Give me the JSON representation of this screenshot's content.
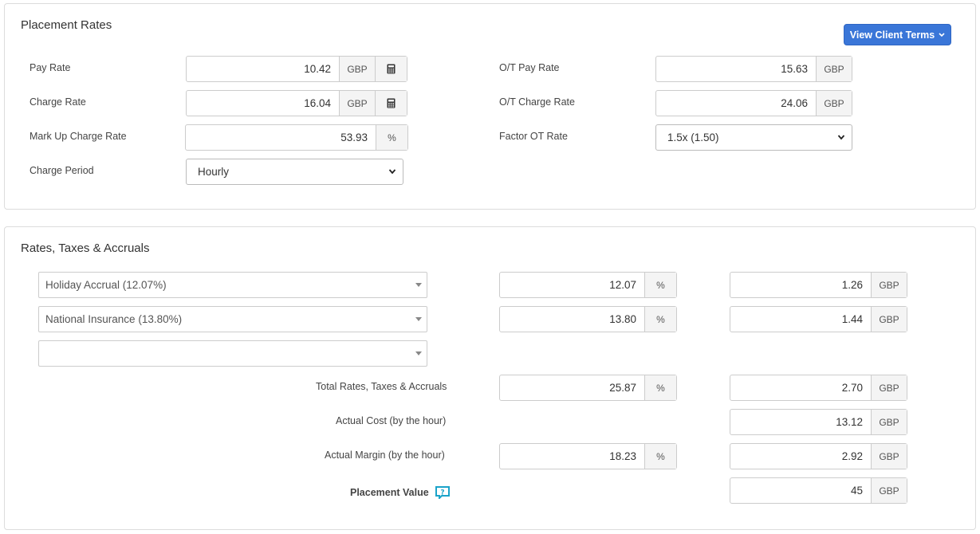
{
  "placement_rates": {
    "title": "Placement Rates",
    "view_client_terms_label": "View Client Terms",
    "pay_rate": {
      "label": "Pay Rate",
      "value": "10.42",
      "unit": "GBP"
    },
    "charge_rate": {
      "label": "Charge Rate",
      "value": "16.04",
      "unit": "GBP"
    },
    "markup": {
      "label": "Mark Up Charge Rate",
      "value": "53.93",
      "unit": "%"
    },
    "charge_period": {
      "label": "Charge Period",
      "value": "Hourly"
    },
    "ot_pay_rate": {
      "label": "O/T Pay Rate",
      "value": "15.63",
      "unit": "GBP"
    },
    "ot_charge_rate": {
      "label": "O/T Charge Rate",
      "value": "24.06",
      "unit": "GBP"
    },
    "factor_ot_rate": {
      "label": "Factor OT Rate",
      "value": "1.5x (1.50)"
    }
  },
  "rates_taxes": {
    "title": "Rates, Taxes & Accruals",
    "rows": [
      {
        "select": "Holiday Accrual (12.07%)",
        "percent": "12.07",
        "pct_unit": "%",
        "amount": "1.26",
        "amount_unit": "GBP"
      },
      {
        "select": "National Insurance (13.80%)",
        "percent": "13.80",
        "pct_unit": "%",
        "amount": "1.44",
        "amount_unit": "GBP"
      },
      {
        "select": ""
      }
    ],
    "total": {
      "label": "Total Rates, Taxes & Accruals",
      "percent": "25.87",
      "pct_unit": "%",
      "amount": "2.70",
      "amount_unit": "GBP"
    },
    "actual_cost": {
      "label": "Actual Cost (by the hour)",
      "amount": "13.12",
      "amount_unit": "GBP"
    },
    "actual_margin": {
      "label": "Actual Margin (by the hour)",
      "percent": "18.23",
      "pct_unit": "%",
      "amount": "2.92",
      "amount_unit": "GBP"
    },
    "placement_value": {
      "label": "Placement Value",
      "amount": "45",
      "amount_unit": "GBP"
    }
  },
  "colors": {
    "primary": "#3a76d8",
    "help_icon": "#1aa3c9"
  },
  "icons": {
    "calculator": "calculator-icon",
    "help": "help-icon",
    "caret": "chevron-down-icon"
  }
}
